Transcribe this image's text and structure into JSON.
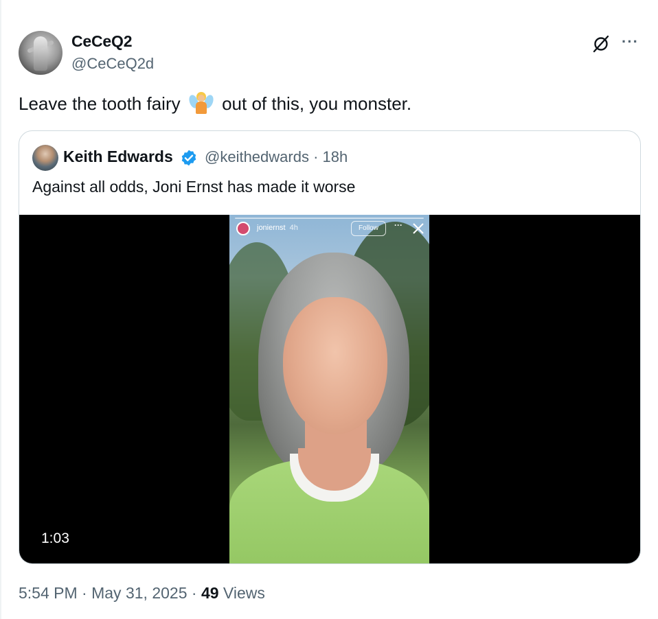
{
  "author": {
    "display_name": "CeCeQ2",
    "handle": "@CeCeQ2d"
  },
  "tweet": {
    "text_before": "Leave the tooth fairy",
    "emoji": "fairy-emoji",
    "text_after": "out of this, you monster."
  },
  "quote": {
    "display_name": "Keith Edwards",
    "handle_time": "@keithedwards · 18h",
    "text": "Against all odds, Joni Ernst has made it worse",
    "verified": true,
    "media": {
      "duration": "1:03",
      "story_user": "joniernst",
      "story_time": "4h",
      "story_follow": "Follow",
      "story_more": "···"
    }
  },
  "meta": {
    "time": "5:54 PM",
    "date": "May 31, 2025",
    "views_count": "49",
    "views_label": "Views"
  },
  "icons": {
    "grok": "grok-icon",
    "more": "more-icon",
    "verified": "verified-badge-icon",
    "close": "close-icon"
  },
  "colors": {
    "secondary_text": "#536471",
    "border": "#cfd9de",
    "verified_blue": "#1d9bf0"
  }
}
